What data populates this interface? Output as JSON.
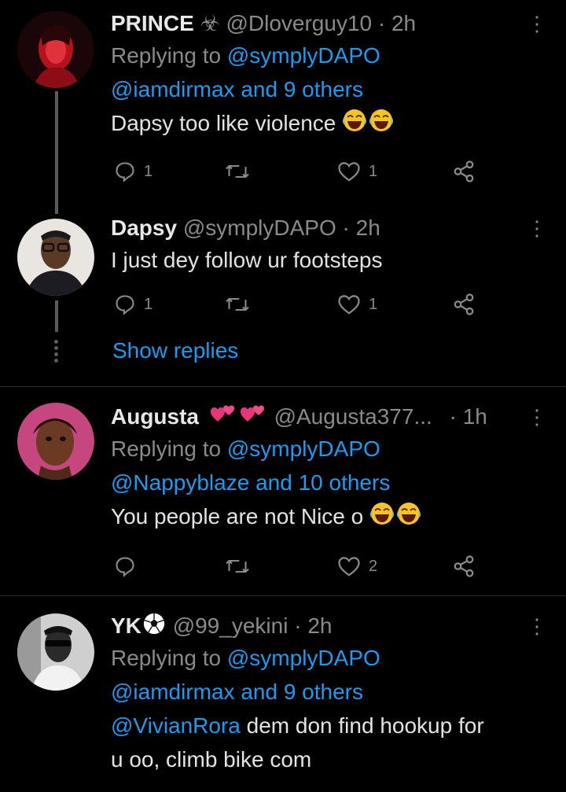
{
  "tweets": [
    {
      "name": "PRINCE",
      "badge": "☣",
      "handle": "@Dloverguy10",
      "time": "2h",
      "replying_prefix": "Replying to ",
      "replying_user": "@symplyDAPO",
      "replying_others": "@iamdirmax and 9 others",
      "text": "Dapsy too like violence",
      "reply_count": "1",
      "retweet_count": "",
      "like_count": "1"
    },
    {
      "name": "Dapsy",
      "handle": "@symplyDAPO",
      "time": "2h",
      "text": "I just dey follow ur footsteps",
      "reply_count": "1",
      "retweet_count": "",
      "like_count": "1"
    },
    {
      "name": "Augusta",
      "handle": "@Augusta377...",
      "time": "1h",
      "replying_prefix": "Replying to ",
      "replying_user": "@symplyDAPO",
      "replying_others": "@Nappyblaze and 10 others",
      "text": "You people are not Nice o",
      "reply_count": "",
      "retweet_count": "",
      "like_count": "2"
    },
    {
      "name": "YK",
      "handle": "@99_yekini",
      "time": "2h",
      "replying_prefix": "Replying to ",
      "replying_user": "@symplyDAPO",
      "replying_others": "@iamdirmax and 9 others",
      "mention": "@VivianRora",
      "text_line1": " dem don find hookup for",
      "text_line2": "u oo, climb bike com"
    }
  ],
  "show_replies_label": "Show replies",
  "separator": "·",
  "more_glyph": "⋮",
  "colors": {
    "accent": "#1d9bf0",
    "muted": "#8a8a8a",
    "background": "#000000"
  }
}
